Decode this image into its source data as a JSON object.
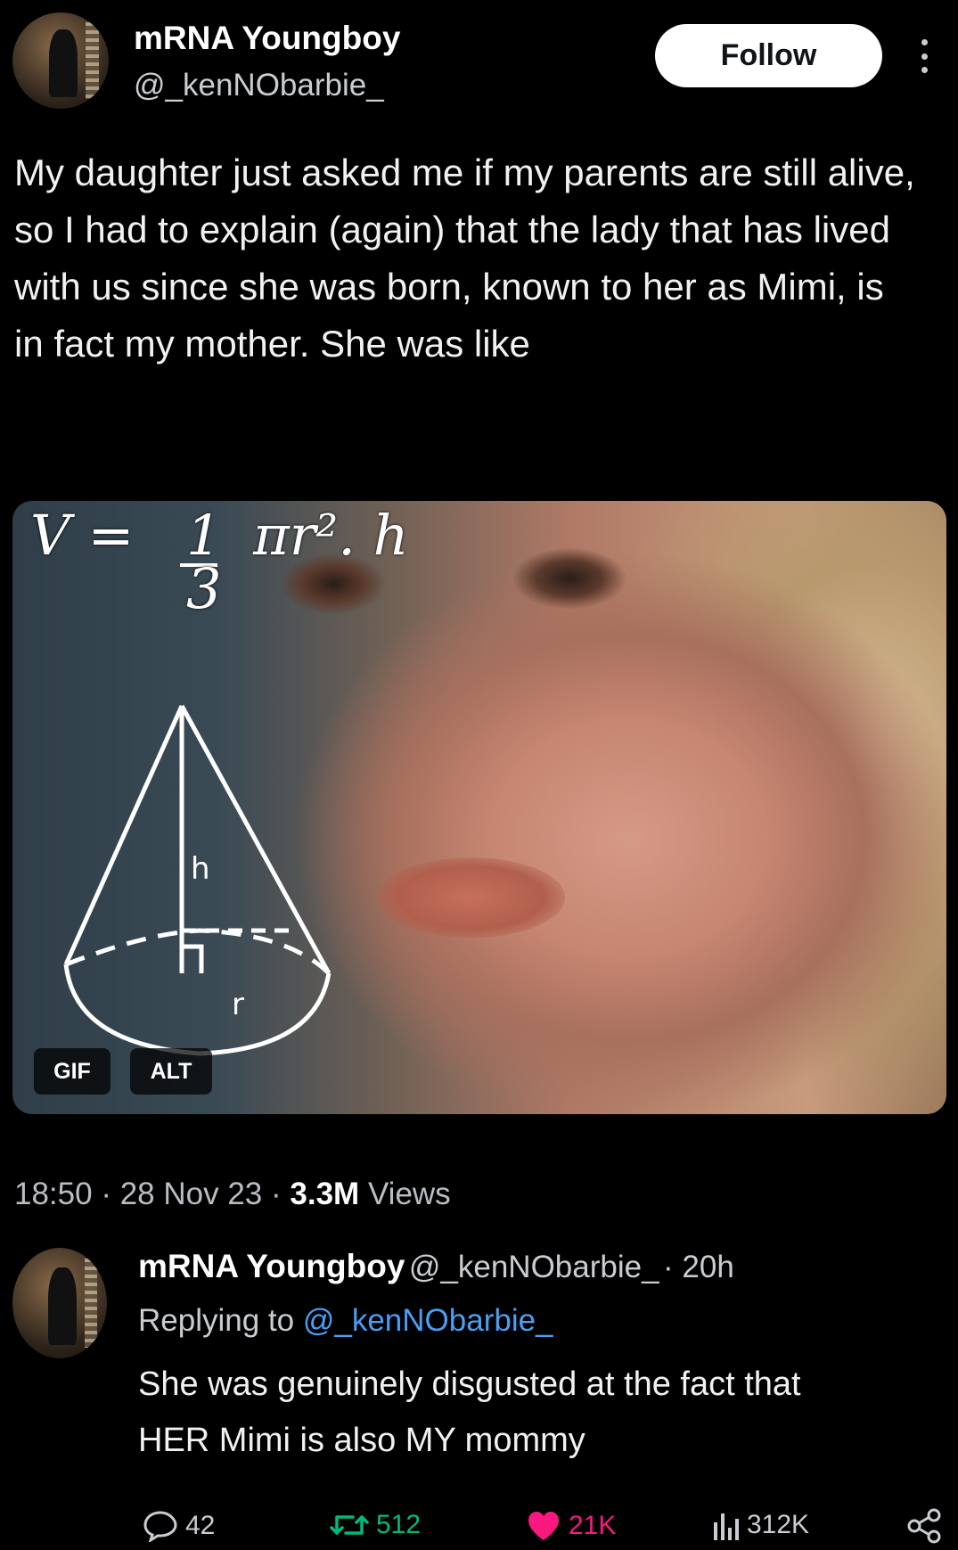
{
  "tweet": {
    "author_name": "mRNA Youngboy",
    "author_handle": "@_kenNObarbie_",
    "follow_label": "Follow",
    "text": "My daughter just asked me if my parents are still alive, so I had to explain (again) that the lady that has lived with us since she was born, known to her as Mimi, is in fact my mother. She was like",
    "media": {
      "formula_v": "V =",
      "formula_num": "1",
      "formula_den": "3",
      "formula_rest": "πr². h",
      "cone_h": "h",
      "cone_r": "r",
      "gif_label": "GIF",
      "alt_label": "ALT"
    },
    "time": "18:50",
    "date": "28 Nov 23",
    "views_count": "3.3M",
    "views_label": "Views"
  },
  "reply": {
    "author_name": "mRNA Youngboy",
    "author_handle": "@_kenNObarbie_",
    "age": "· 20h",
    "replying_to_label": "Replying to",
    "replying_to_handle": "@_kenNObarbie_",
    "text_line1": "She was genuinely disgusted at the fact that",
    "text_line2": "HER Mimi is also MY mommy",
    "actions": {
      "replies": "42",
      "retweets": "512",
      "likes": "21K",
      "views": "312K"
    }
  },
  "colors": {
    "background": "#000000",
    "link": "#4a9ef5",
    "retweet": "#00ba7c",
    "like": "#f91880"
  }
}
